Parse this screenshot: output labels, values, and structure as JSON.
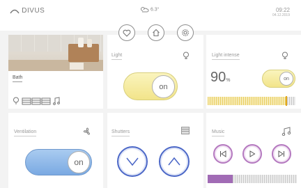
{
  "header": {
    "logo_text": "DIVUS",
    "weather_temp": "6.3°",
    "time": "09:22",
    "date": "04.12.2019"
  },
  "nav": {
    "favorites_icon": "heart-icon",
    "home_icon": "home-icon",
    "settings_icon": "gear-icon"
  },
  "tiles": {
    "bath": {
      "label": "Bath"
    },
    "light": {
      "label": "Light",
      "state": "on"
    },
    "light_intensity": {
      "label": "Light intense",
      "value": "90",
      "unit": "%",
      "level": 0.9,
      "state": "on"
    },
    "ventilation": {
      "label": "Ventilation",
      "state": "on"
    },
    "shutters": {
      "label": "Shutters"
    },
    "music": {
      "label": "Music",
      "level": 0.28
    }
  },
  "colors": {
    "yellow_toggle": "#f5eb9a",
    "blue_toggle": "#8db9ea",
    "shutter_ring": "#4b67c7",
    "music_ring": "#b478bf",
    "level_bar": "#e3b32a",
    "music_bar": "#a16bb5"
  }
}
